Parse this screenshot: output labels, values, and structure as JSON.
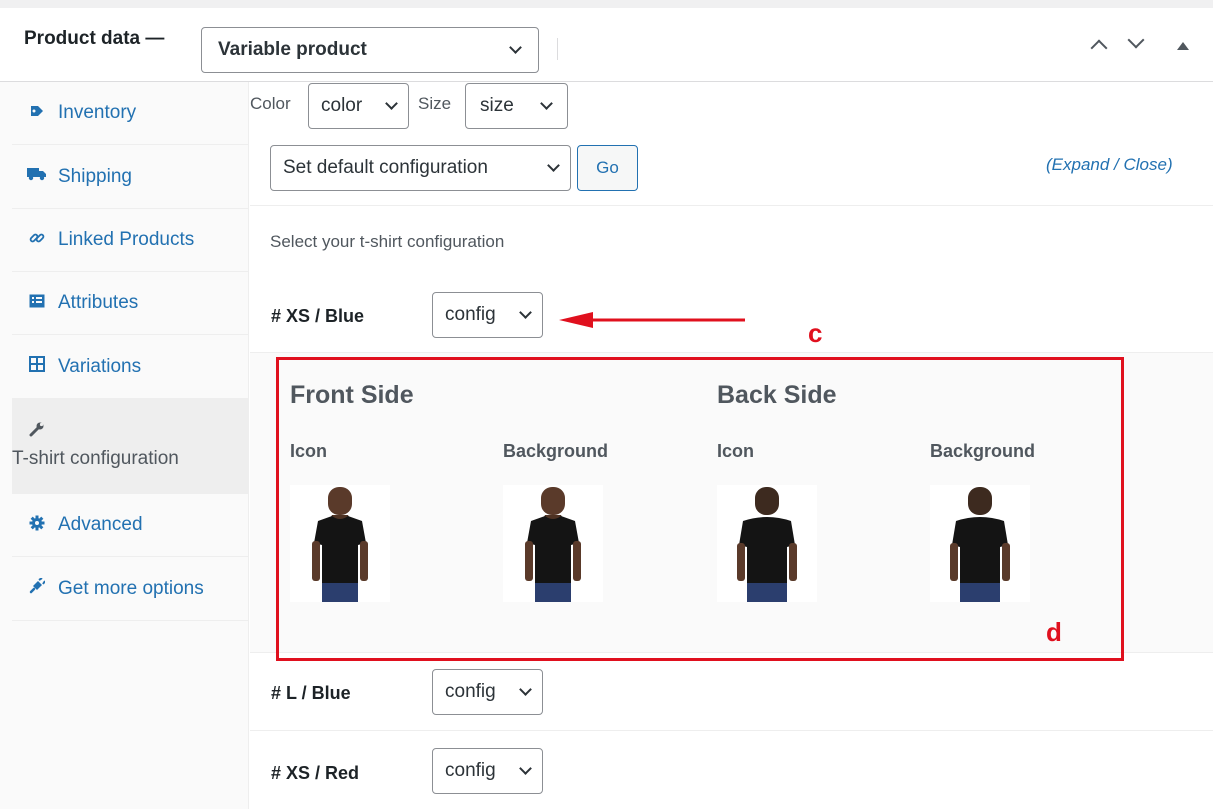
{
  "header": {
    "title": "Product data —",
    "product_type": "Variable product"
  },
  "sidebar": {
    "items": [
      {
        "label": "Inventory",
        "icon": "inventory-icon"
      },
      {
        "label": "Shipping",
        "icon": "truck-icon"
      },
      {
        "label": "Linked Products",
        "icon": "link-icon"
      },
      {
        "label": "Attributes",
        "icon": "list-icon"
      },
      {
        "label": "Variations",
        "icon": "grid-icon"
      },
      {
        "label": "T-shirt configuration",
        "icon": "wrench-icon",
        "active": true
      },
      {
        "label": "Advanced",
        "icon": "gear-icon"
      },
      {
        "label": "Get more options",
        "icon": "plugin-icon"
      }
    ]
  },
  "filters": {
    "color_label": "Color",
    "color_value": "color",
    "size_label": "Size",
    "size_value": "size"
  },
  "toolbar": {
    "default_config": "Set default configuration",
    "go_label": "Go",
    "expand_label": "(Expand / Close)"
  },
  "config": {
    "intro": "Select your t-shirt configuration",
    "rows": [
      {
        "label": "# XS / Blue",
        "select": "config"
      },
      {
        "label": "# L / Blue",
        "select": "config"
      },
      {
        "label": "# XS / Red",
        "select": "config"
      }
    ],
    "front_title": "Front Side",
    "back_title": "Back Side",
    "icon_label": "Icon",
    "background_label": "Background"
  },
  "annotations": {
    "c": "c",
    "d": "d",
    "color": "#e0101e"
  },
  "colors": {
    "accent": "#2271b1",
    "annotation": "#e0101e"
  }
}
